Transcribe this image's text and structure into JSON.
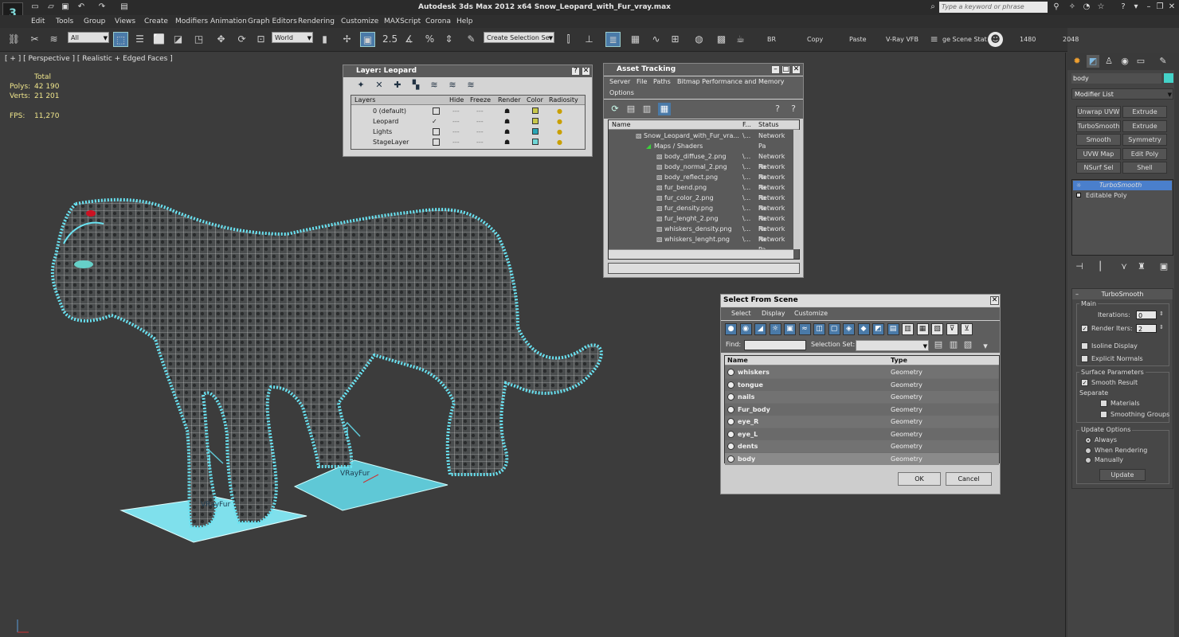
{
  "app": {
    "title": "Autodesk 3ds Max  2012 x64     Snow_Leopard_with_Fur_vray.max",
    "search_placeholder": "Type a keyword or phrase",
    "logo": "3"
  },
  "menu": [
    "Edit",
    "Tools",
    "Group",
    "Views",
    "Create",
    "Modifiers",
    "Animation",
    "Graph Editors",
    "Rendering",
    "Customize",
    "MAXScript",
    "Corona",
    "Help"
  ],
  "toolbar": {
    "filter": "All",
    "coord": "World",
    "selset_placeholder": "Create Selection Se",
    "labels": [
      "BR",
      "Copy",
      "Paste",
      "V-Ray VFB",
      "ge Scene Stat",
      "1480",
      "2048"
    ],
    "snap_angle": "2.5"
  },
  "viewport": {
    "label": "[ + ] [ Perspective ] [ Realistic + Edged Faces ]",
    "stats": {
      "total_label": "Total",
      "polys_label": "Polys:",
      "polys": "42 190",
      "verts_label": "Verts:",
      "verts": "21 201",
      "fps_label": "FPS:",
      "fps": "11,270"
    },
    "helper_labels": [
      "VRayFur",
      "VRayFur"
    ]
  },
  "layer_dialog": {
    "title": "Layer: Leopard",
    "columns": [
      "Layers",
      "Hide",
      "Freeze",
      "Render",
      "Color",
      "Radiosity"
    ],
    "rows": [
      {
        "name": "0 (default)",
        "color": "#c8c84a"
      },
      {
        "name": "Leopard",
        "color": "#c8c84a"
      },
      {
        "name": "Lights",
        "color": "#2aa6b6"
      },
      {
        "name": "StageLayer",
        "color": "#6fd6d6"
      }
    ]
  },
  "asset_dialog": {
    "title": "Asset Tracking",
    "menu": [
      "Server",
      "File",
      "Paths",
      "Bitmap Performance and Memory",
      "Options"
    ],
    "columns": [
      "Name",
      "F...",
      "Status"
    ],
    "root": "Snow_Leopard_with_Fur_vra...",
    "group": "Maps / Shaders",
    "files": [
      "body_diffuse_2.png",
      "body_normal_2.png",
      "body_reflect.png",
      "fur_bend.png",
      "fur_color_2.png",
      "fur_density.png",
      "fur_lenght_2.png",
      "whiskers_density.png",
      "whiskers_lenght.png"
    ],
    "fcol": "\\...",
    "status": "Network Pa"
  },
  "select_dialog": {
    "title": "Select From Scene",
    "menu": [
      "Select",
      "Display",
      "Customize"
    ],
    "find_label": "Find:",
    "selset_label": "Selection Set:",
    "columns": [
      "Name",
      "Type"
    ],
    "rows": [
      {
        "name": "whiskers",
        "type": "Geometry"
      },
      {
        "name": "tongue",
        "type": "Geometry"
      },
      {
        "name": "nails",
        "type": "Geometry"
      },
      {
        "name": "Fur_body",
        "type": "Geometry"
      },
      {
        "name": "eye_R",
        "type": "Geometry"
      },
      {
        "name": "eye_L",
        "type": "Geometry"
      },
      {
        "name": "dents",
        "type": "Geometry"
      },
      {
        "name": "body",
        "type": "Geometry"
      }
    ],
    "ok": "OK",
    "cancel": "Cancel"
  },
  "command_panel": {
    "object_name": "body",
    "object_color": "#44d2c8",
    "modifier_list": "Modifier List",
    "buttons": [
      "Unwrap UVW",
      "Extrude",
      "TurboSmooth",
      "Extrude",
      "Smooth",
      "Symmetry",
      "UVW Map",
      "Edit Poly",
      "NSurf Sel",
      "Shell"
    ],
    "stack": [
      "TurboSmooth",
      "Editable Poly"
    ],
    "turbosmooth": {
      "title": "TurboSmooth",
      "main": "Main",
      "iterations_label": "Iterations:",
      "iterations": "0",
      "render_iters_label": "Render Iters:",
      "render_iters": "2",
      "isoline": "Isoline Display",
      "explicit": "Explicit Normals",
      "surface": "Surface Parameters",
      "smooth_result": "Smooth Result",
      "separate": "Separate",
      "materials": "Materials",
      "smoothing_groups": "Smoothing Groups",
      "update_options": "Update Options",
      "always": "Always",
      "when_rendering": "When Rendering",
      "manually": "Manually",
      "update": "Update"
    }
  }
}
